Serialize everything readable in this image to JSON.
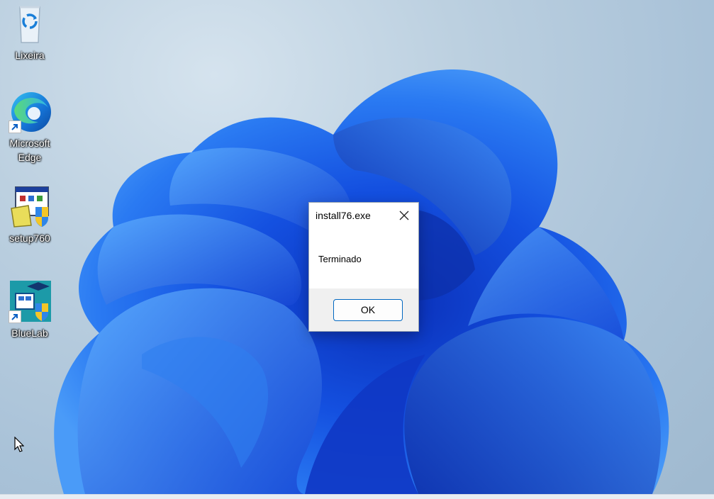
{
  "desktop": {
    "icons": [
      {
        "label": "Lixeira",
        "icon": "recycle-bin-icon"
      },
      {
        "label": "Microsoft\nEdge",
        "icon": "edge-icon"
      },
      {
        "label": "setup760",
        "icon": "installer-icon"
      },
      {
        "label": "BlueLab",
        "icon": "bluelab-icon"
      }
    ]
  },
  "dialog": {
    "title": "install76.exe",
    "message": "Terminado",
    "ok_label": "OK"
  },
  "colors": {
    "accent": "#0067c0",
    "bloom": "#1f5fe0"
  }
}
